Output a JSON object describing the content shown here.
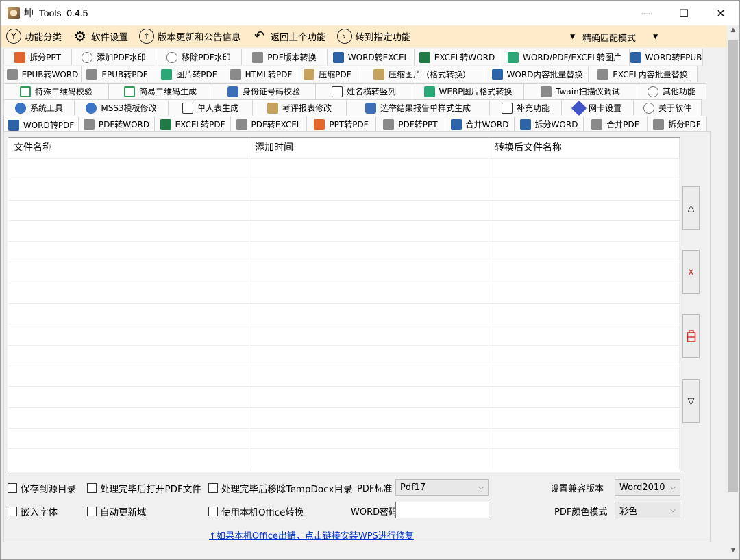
{
  "window": {
    "title": "坤_Tools_0.4.5",
    "minimize": "—",
    "maximize": "☐",
    "close": "✕"
  },
  "menu": {
    "items": [
      {
        "label": "功能分类",
        "icon": "menu-category-icon",
        "glyph": "Y"
      },
      {
        "label": "软件设置",
        "icon": "gear-icon",
        "glyph": "⚙"
      },
      {
        "label": "版本更新和公告信息",
        "icon": "arrow-up-icon",
        "glyph": "↑"
      },
      {
        "label": "返回上个功能",
        "icon": "back-arrow-icon",
        "glyph": "↶"
      },
      {
        "label": "转到指定功能",
        "icon": "arrow-right-icon",
        "glyph": "›"
      }
    ],
    "function_combo_value": "",
    "match_mode_value": "精确匹配模式"
  },
  "tabs": {
    "row1": [
      {
        "label": "拆分PPT",
        "icon": "ppt"
      },
      {
        "label": "添加PDF水印",
        "icon": "wm"
      },
      {
        "label": "移除PDF水印",
        "icon": "wm"
      },
      {
        "label": "PDF版本转换",
        "icon": "gray"
      },
      {
        "label": "WORD转EXCEL",
        "icon": "word"
      },
      {
        "label": "EXCEL转WORD",
        "icon": "excel"
      },
      {
        "label": "WORD/PDF/EXCEL转图片",
        "icon": "img"
      },
      {
        "label": "WORD转EPUB",
        "icon": "word"
      }
    ],
    "row2": [
      {
        "label": "EPUB转WORD",
        "icon": "gray"
      },
      {
        "label": "EPUB转PDF",
        "icon": "gray"
      },
      {
        "label": "图片转PDF",
        "icon": "img"
      },
      {
        "label": "HTML转PDF",
        "icon": "gray"
      },
      {
        "label": "压缩PDF",
        "icon": "stack"
      },
      {
        "label": "压缩图片（格式转换）",
        "icon": "stack"
      },
      {
        "label": "WORD内容批量替换",
        "icon": "word"
      },
      {
        "label": "EXCEL内容批量替换",
        "icon": "gray"
      }
    ],
    "row3": [
      {
        "label": "特殊二维码校验",
        "icon": "qr"
      },
      {
        "label": "简易二维码生成",
        "icon": "qr"
      },
      {
        "label": "身份证号码校验",
        "icon": "id"
      },
      {
        "label": "姓名横转竖列",
        "icon": "doc"
      },
      {
        "label": "WEBP图片格式转换",
        "icon": "img"
      },
      {
        "label": "Twain扫描仪调试",
        "icon": "gray"
      },
      {
        "label": "其他功能",
        "icon": "info"
      }
    ],
    "row4": [
      {
        "label": "系统工具",
        "icon": "gear"
      },
      {
        "label": "MSS3模板修改",
        "icon": "gear"
      },
      {
        "label": "单人表生成",
        "icon": "doc"
      },
      {
        "label": "考评报表修改",
        "icon": "stack"
      },
      {
        "label": "选举结果报告单样式生成",
        "icon": "id"
      },
      {
        "label": "补充功能",
        "icon": "doc"
      },
      {
        "label": "网卡设置",
        "icon": "net"
      },
      {
        "label": "关于软件",
        "icon": "info"
      }
    ],
    "row5": [
      {
        "label": "WORD转PDF",
        "icon": "word",
        "selected": true
      },
      {
        "label": "PDF转WORD",
        "icon": "gray"
      },
      {
        "label": "EXCEL转PDF",
        "icon": "excel"
      },
      {
        "label": "PDF转EXCEL",
        "icon": "gray"
      },
      {
        "label": "PPT转PDF",
        "icon": "ppt"
      },
      {
        "label": "PDF转PPT",
        "icon": "gray"
      },
      {
        "label": "合并WORD",
        "icon": "word"
      },
      {
        "label": "拆分WORD",
        "icon": "word"
      },
      {
        "label": "合并PDF",
        "icon": "gray"
      },
      {
        "label": "拆分PDF",
        "icon": "gray"
      }
    ]
  },
  "file_table": {
    "columns": [
      "文件名称",
      "添加时间",
      "转换后文件名称"
    ],
    "rows": []
  },
  "side_buttons": {
    "move_up": "△",
    "remove": "x",
    "clear": "⌫",
    "move_down": "▽"
  },
  "options": {
    "save_to_source_dir": "保存到源目录",
    "open_pdf_after": "处理完毕后打开PDF文件",
    "remove_tempdocx_after": "处理完毕后移除TempDocx目录",
    "pdf_standard_label": "PDF标准",
    "pdf_standard_value": "Pdf17",
    "compat_version_label": "设置兼容版本",
    "compat_version_value": "Word2010",
    "embed_fonts": "嵌入字体",
    "auto_update_fields": "自动更新域",
    "use_local_office": "使用本机Office转换",
    "word_password_label": "WORD密码",
    "word_password_value": "",
    "pdf_color_mode_label": "PDF颜色模式",
    "pdf_color_mode_value": "彩色",
    "help_link": "↑如果本机Office出错，点击链接安装WPS进行修复"
  },
  "colors": {
    "menubar_bg": "#fdebc9",
    "link": "#0033cc",
    "clear_icon": "#d32f2f"
  }
}
